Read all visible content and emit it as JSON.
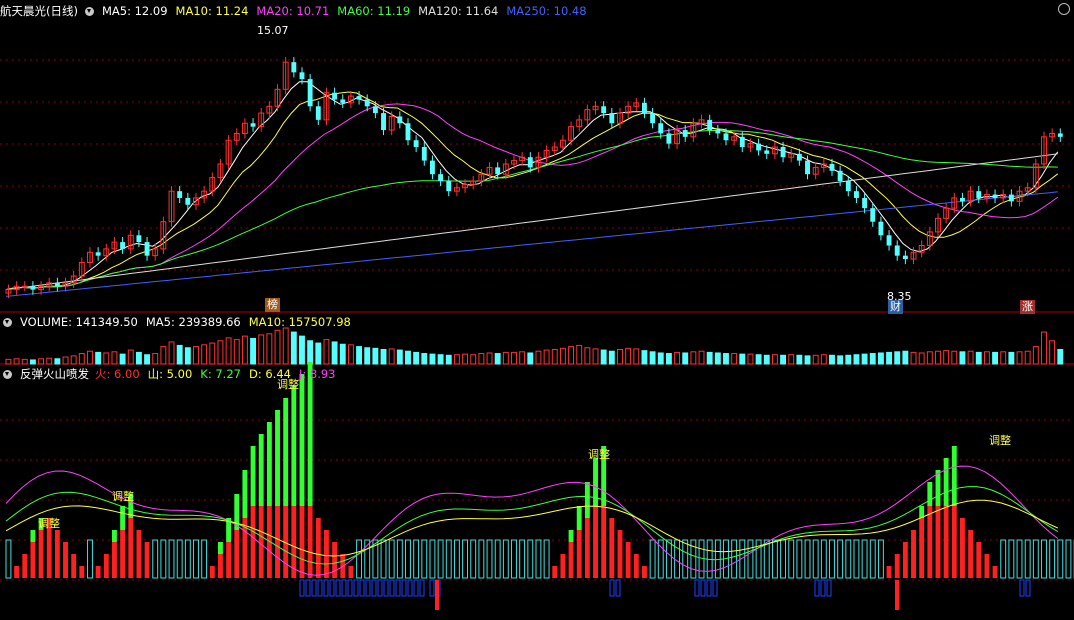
{
  "header": {
    "title": "航天晨光(日线)",
    "ma": [
      {
        "label": "MA5: 12.09",
        "color": "#ffffff"
      },
      {
        "label": "MA10: 11.24",
        "color": "#ffff40"
      },
      {
        "label": "MA20: 10.71",
        "color": "#ff40ff"
      },
      {
        "label": "MA60: 11.19",
        "color": "#40ff40"
      },
      {
        "label": "MA120: 11.64",
        "color": "#dddddd"
      },
      {
        "label": "MA250: 10.48",
        "color": "#4060ff"
      }
    ]
  },
  "volume_header": {
    "items": [
      {
        "label": "VOLUME: 141349.50",
        "color": "#ffffff"
      },
      {
        "label": "MA5: 239389.66",
        "color": "#ffffff"
      },
      {
        "label": "MA10: 157507.98",
        "color": "#ffff40"
      }
    ]
  },
  "indicator_header": {
    "name": "反弹火山喷发",
    "items": [
      {
        "label": "火: 6.00",
        "color": "#ff3030"
      },
      {
        "label": "山: 5.00",
        "color": "#ffff40"
      },
      {
        "label": "K: 7.27",
        "color": "#40ff40"
      },
      {
        "label": "D: 6.44",
        "color": "#ffff40"
      },
      {
        "label": "J: 8.93",
        "color": "#ff40ff"
      }
    ]
  },
  "annotations": {
    "high_label": "15.07",
    "low_label": "8.35",
    "tag_bang": "榜",
    "tag_cai": "财",
    "tag_zhang": "涨",
    "adjust": "调整"
  },
  "colors": {
    "up": "#ff3232",
    "down": "#54ffff",
    "grid": "#8b0000",
    "macd_pos": "#ff2020",
    "macd_neg": "#2040ff",
    "bar_green": "#30ff30",
    "bar_cyan": "#40e0e0"
  },
  "chart_data": [
    {
      "type": "candlestick",
      "series": [
        {
          "name": "MA5",
          "color": "#ffffff"
        },
        {
          "name": "MA10",
          "color": "#ffff40"
        },
        {
          "name": "MA20",
          "color": "#ff40ff"
        },
        {
          "name": "MA60",
          "color": "#40ff40"
        },
        {
          "name": "MA120",
          "color": "#dddddd"
        },
        {
          "name": "MA250",
          "color": "#4060ff"
        }
      ],
      "close": [
        7.6,
        7.7,
        7.7,
        7.6,
        7.7,
        7.8,
        7.7,
        7.8,
        8.0,
        8.4,
        8.7,
        8.6,
        8.8,
        9.0,
        8.8,
        9.2,
        9.0,
        8.6,
        8.8,
        9.6,
        10.5,
        10.3,
        10.1,
        10.3,
        10.5,
        10.9,
        11.3,
        12.0,
        12.2,
        12.5,
        12.4,
        12.8,
        13.0,
        13.5,
        14.3,
        14.0,
        13.8,
        13.0,
        12.6,
        13.4,
        13.2,
        13.1,
        13.3,
        13.2,
        13.0,
        12.8,
        12.3,
        12.7,
        12.5,
        12.0,
        11.8,
        11.4,
        11.0,
        10.8,
        10.5,
        10.6,
        10.7,
        10.8,
        11.0,
        11.2,
        11.0,
        11.3,
        11.4,
        11.5,
        11.2,
        11.5,
        11.7,
        11.8,
        12.0,
        12.4,
        12.6,
        12.9,
        13.0,
        12.8,
        12.5,
        12.8,
        13.0,
        13.1,
        12.8,
        12.5,
        12.2,
        11.9,
        12.3,
        12.1,
        12.5,
        12.6,
        12.3,
        12.2,
        12.0,
        12.1,
        11.8,
        11.9,
        11.7,
        11.6,
        11.8,
        11.5,
        11.6,
        11.4,
        11.0,
        11.2,
        11.3,
        11.1,
        10.8,
        10.5,
        10.3,
        10.0,
        9.6,
        9.2,
        8.9,
        8.6,
        8.5,
        8.7,
        8.9,
        9.3,
        9.7,
        10.0,
        10.3,
        10.2,
        10.5,
        10.3,
        10.4,
        10.3,
        10.4,
        10.2,
        10.5,
        10.6,
        11.3,
        12.1,
        12.2,
        12.1
      ],
      "high": 15.07,
      "low": 8.35,
      "ylim": [
        7.0,
        15.6
      ]
    },
    {
      "type": "bar",
      "title": "VOLUME",
      "values": [
        8,
        9,
        8,
        7,
        9,
        10,
        9,
        12,
        14,
        18,
        22,
        20,
        19,
        21,
        17,
        24,
        20,
        16,
        18,
        30,
        38,
        32,
        28,
        30,
        33,
        36,
        40,
        45,
        42,
        48,
        44,
        50,
        52,
        58,
        62,
        55,
        48,
        40,
        36,
        42,
        38,
        34,
        33,
        30,
        28,
        27,
        25,
        26,
        24,
        22,
        20,
        18,
        17,
        16,
        15,
        16,
        17,
        16,
        18,
        19,
        18,
        20,
        20,
        21,
        19,
        22,
        24,
        25,
        27,
        30,
        32,
        28,
        26,
        24,
        22,
        25,
        27,
        26,
        23,
        21,
        19,
        18,
        20,
        19,
        21,
        22,
        20,
        19,
        18,
        18,
        17,
        17,
        16,
        15,
        16,
        15,
        16,
        15,
        14,
        15,
        16,
        15,
        14,
        15,
        16,
        17,
        18,
        19,
        20,
        21,
        22,
        20,
        19,
        21,
        22,
        23,
        22,
        21,
        22,
        20,
        21,
        20,
        21,
        20,
        21,
        22,
        30,
        55,
        40,
        25
      ]
    },
    {
      "type": "bar",
      "title": "反弹火山喷发",
      "red": [
        0,
        1,
        2,
        3,
        4,
        5,
        4,
        3,
        2,
        1,
        0,
        1,
        2,
        3,
        4,
        5,
        4,
        3,
        0,
        0,
        0,
        0,
        0,
        0,
        0,
        1,
        2,
        3,
        4,
        5,
        6,
        6,
        6,
        6,
        6,
        6,
        6,
        6,
        5,
        4,
        3,
        2,
        1,
        0,
        0,
        0,
        0,
        0,
        0,
        0,
        0,
        0,
        0,
        0,
        0,
        0,
        0,
        0,
        0,
        0,
        0,
        0,
        0,
        0,
        0,
        0,
        0,
        1,
        2,
        3,
        4,
        5,
        6,
        6,
        5,
        4,
        3,
        2,
        1,
        0,
        0,
        0,
        0,
        0,
        0,
        0,
        0,
        0,
        0,
        0,
        0,
        0,
        0,
        0,
        0,
        0,
        0,
        0,
        0,
        0,
        0,
        0,
        0,
        0,
        0,
        0,
        0,
        0,
        1,
        2,
        3,
        4,
        5,
        6,
        6,
        6,
        6,
        5,
        4,
        3,
        2,
        1,
        0,
        0,
        0,
        0,
        0,
        0,
        0,
        0,
        0,
        0,
        0,
        0
      ],
      "green": [
        0,
        0,
        0,
        1,
        1,
        0,
        0,
        0,
        0,
        0,
        0,
        0,
        0,
        1,
        2,
        2,
        0,
        0,
        0,
        0,
        0,
        0,
        0,
        0,
        0,
        0,
        1,
        2,
        3,
        4,
        5,
        6,
        7,
        8,
        9,
        10,
        11,
        12,
        0,
        0,
        0,
        0,
        0,
        0,
        0,
        0,
        0,
        0,
        0,
        0,
        0,
        0,
        0,
        0,
        0,
        0,
        0,
        0,
        0,
        0,
        0,
        0,
        0,
        0,
        0,
        0,
        0,
        0,
        0,
        1,
        2,
        3,
        4,
        5,
        0,
        0,
        0,
        0,
        0,
        0,
        0,
        0,
        0,
        0,
        0,
        0,
        0,
        0,
        0,
        0,
        0,
        0,
        0,
        0,
        0,
        0,
        0,
        0,
        0,
        0,
        0,
        0,
        0,
        0,
        0,
        0,
        0,
        0,
        0,
        0,
        0,
        0,
        1,
        2,
        3,
        4,
        5,
        0,
        0,
        0,
        0,
        0,
        0,
        0,
        0,
        0,
        0,
        0,
        0,
        0,
        0,
        0,
        0
      ]
    }
  ]
}
